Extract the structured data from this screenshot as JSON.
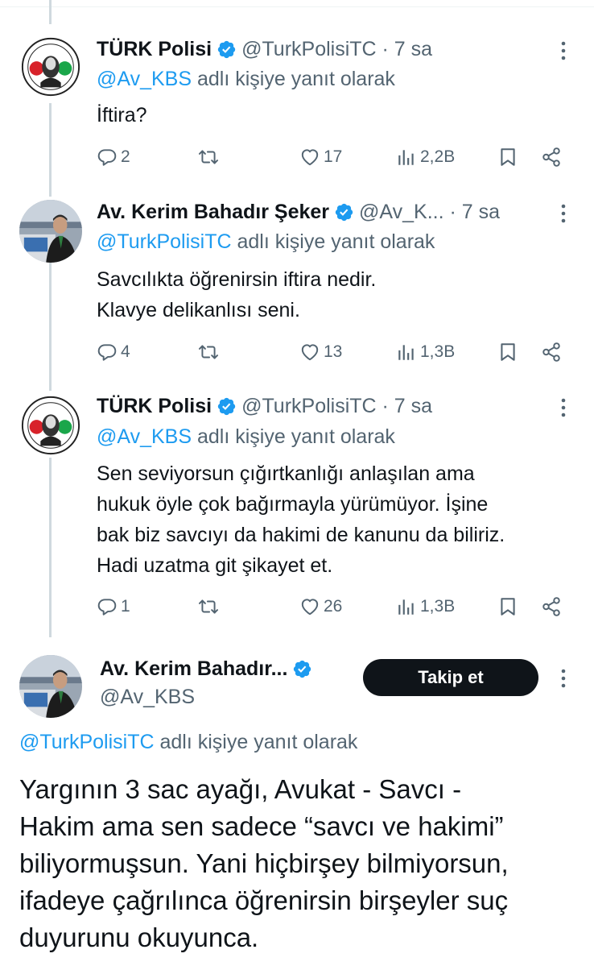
{
  "tweets": [
    {
      "name": "TÜRK Polisi",
      "handle": "@TurkPolisiTC · 7 sa",
      "reply_at": "@Av_KBS",
      "reply_suffix": " adlı kişiye yanıt olarak",
      "lines": [
        "İftira?"
      ],
      "replies": "2",
      "likes": "17",
      "views": "2,2B",
      "avatar": "turk-polisi-logo"
    },
    {
      "name": "Av. Kerim Bahadır Şeker",
      "handle": "@Av_K... · 7 sa",
      "reply_at": "@TurkPolisiTC",
      "reply_suffix": " adlı kişiye yanıt olarak",
      "lines": [
        "Savcılıkta öğrenirsin iftira nedir.",
        "Klavye delikanlısı seni."
      ],
      "replies": "4",
      "likes": "13",
      "views": "1,3B",
      "avatar": "lawyer-photo"
    },
    {
      "name": "TÜRK Polisi",
      "handle": "@TurkPolisiTC · 7 sa",
      "reply_at": "@Av_KBS",
      "reply_suffix": " adlı kişiye yanıt olarak",
      "lines": [
        "Sen seviyorsun çığırtkanlığı anlaşılan ama",
        "hukuk öyle çok bağırmayla yürümüyor. İşine",
        "bak biz savcıyı da hakimi de kanunu da biliriz.",
        "Hadi uzatma git şikayet et."
      ],
      "replies": "1",
      "likes": "26",
      "views": "1,3B",
      "avatar": "turk-polisi-logo"
    }
  ],
  "main": {
    "name": "Av. Kerim Bahadır...",
    "handle": "@Av_KBS",
    "follow_label": "Takip et",
    "reply_at": "@TurkPolisiTC",
    "reply_suffix": " adlı kişiye yanıt olarak",
    "lines": [
      "Yargının 3 sac ayağı, Avukat - Savcı -",
      "Hakim ama sen sadece “savcı ve hakimi”",
      "biliyormuşsun. Yani hiçbirşey bilmiyorsun,",
      "ifadeye çağrılınca öğrenirsin birşeyler suç",
      "duyurunu okuyunca."
    ]
  },
  "logo_text": {
    "top": "TÜRK POLİSİ",
    "year": "2012"
  },
  "colors": {
    "accent": "#1d9bf0",
    "muted": "#536471",
    "text": "#0f1419",
    "button": "#0f1419"
  },
  "icons": [
    "verified-badge-icon",
    "more-icon",
    "reply-icon",
    "retweet-icon",
    "like-icon",
    "views-icon",
    "bookmark-icon",
    "share-icon"
  ]
}
